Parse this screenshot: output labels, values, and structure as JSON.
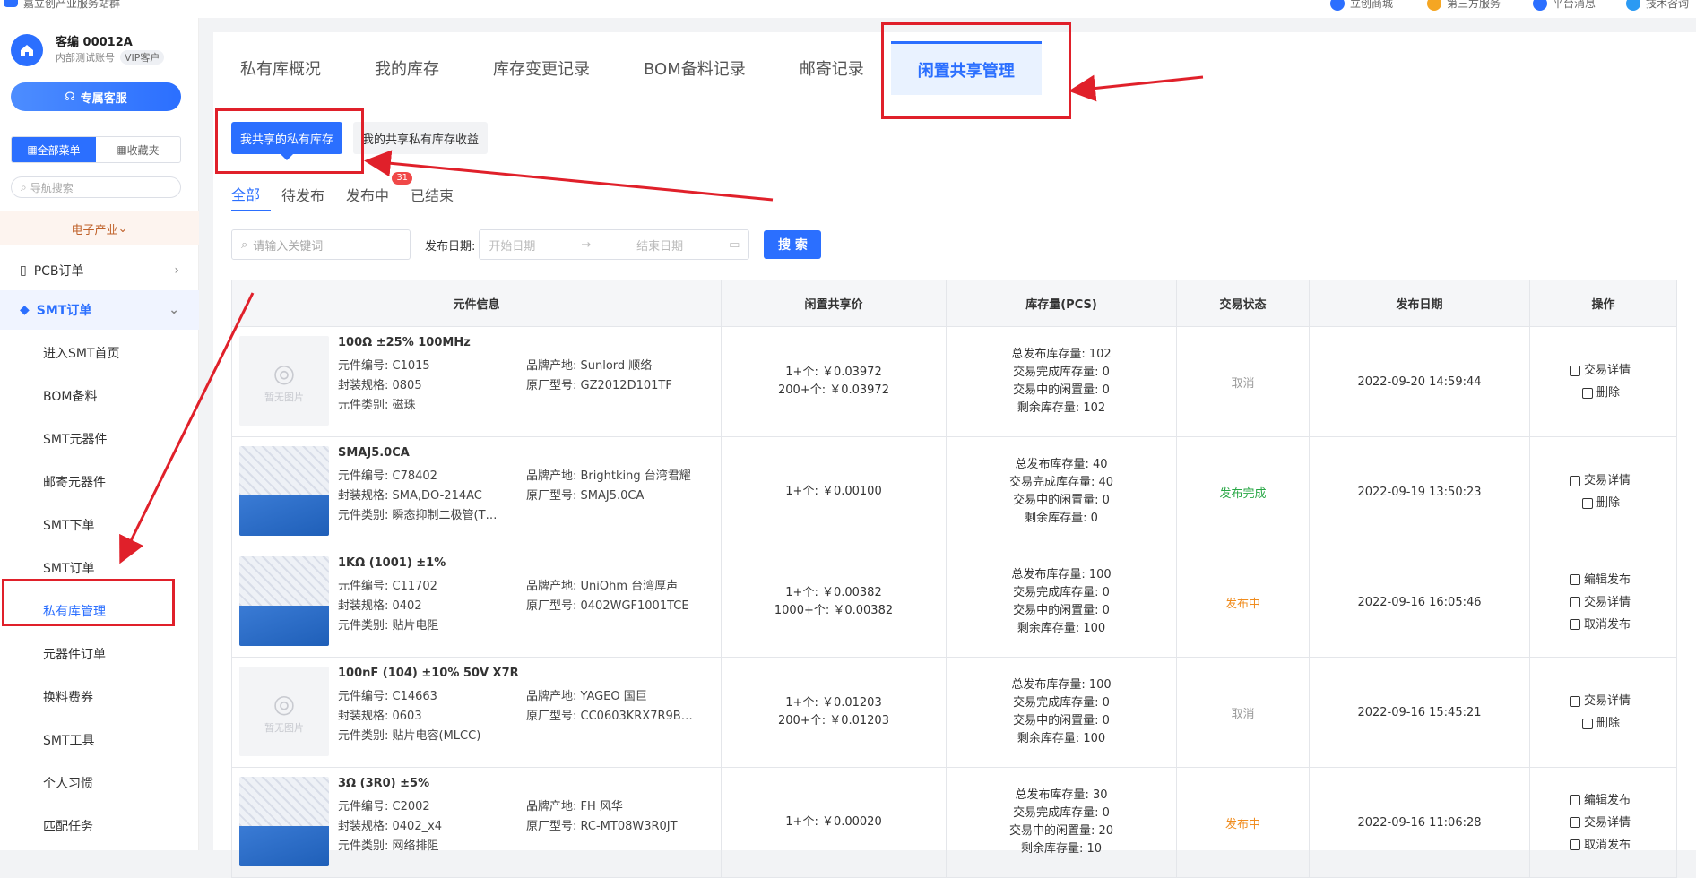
{
  "topbar": {
    "site_name": "嘉立创产业服务站群",
    "links": [
      "立创商城",
      "第三方服务",
      "平台消息",
      "技术咨询"
    ]
  },
  "sidebar": {
    "account_name": "客编 00012A",
    "account_sub": "内部测试账号",
    "vip_label": "VIP客户",
    "service_button": "专属客服",
    "menu_tabs": [
      "全部菜单",
      "收藏夹"
    ],
    "nav_search_placeholder": "导航搜索",
    "industry": "电子产业",
    "groups": [
      {
        "label": "PCB订单",
        "expanded": false
      },
      {
        "label": "SMT订单",
        "expanded": true
      }
    ],
    "items": [
      "进入SMT首页",
      "BOM备料",
      "SMT元器件",
      "邮寄元器件",
      "SMT下单",
      "SMT订单",
      "私有库管理",
      "元器件订单",
      "换料费券",
      "SMT工具",
      "个人习惯",
      "匹配任务"
    ],
    "current_item": "私有库管理"
  },
  "page_tabs": [
    "私有库概况",
    "我的库存",
    "库存变更记录",
    "BOM备料记录",
    "邮寄记录",
    "闲置共享管理"
  ],
  "active_page_tab": "闲置共享管理",
  "sub_tabs": [
    "我共享的私有库存",
    "我的共享私有库存收益"
  ],
  "status_tabs": [
    {
      "label": "全部",
      "badge": ""
    },
    {
      "label": "待发布",
      "badge": ""
    },
    {
      "label": "发布中",
      "badge": "31"
    },
    {
      "label": "已结束",
      "badge": ""
    }
  ],
  "filter": {
    "keyword_placeholder": "请输入关键词",
    "date_label": "发布日期:",
    "start_placeholder": "开始日期",
    "end_placeholder": "结束日期",
    "search_label": "搜 索"
  },
  "table": {
    "headers": [
      "元件信息",
      "闲置共享价",
      "库存量(PCS)",
      "交易状态",
      "发布日期",
      "操作"
    ],
    "placeholder_image_text": "暂无图片",
    "rows": [
      {
        "name": "100Ω ±25% 100MHz",
        "thumb": "placeholder",
        "code": "元件编号: C1015",
        "pkg": "封装规格: 0805",
        "cat": "元件类别: 磁珠",
        "brand": "品牌产地: Sunlord 顺络",
        "model": "原厂型号: GZ2012D101TF",
        "prices": [
          "1+个: ￥0.03972",
          "200+个: ￥0.03972"
        ],
        "stock": [
          "总发布库存量: 102",
          "交易完成库存量: 0",
          "交易中的闲置量: 0",
          "剩余库存量: 102"
        ],
        "status": "取消",
        "status_color": "gray",
        "date": "2022-09-20 14:59:44",
        "ops": [
          "交易详情",
          "删除"
        ]
      },
      {
        "name": "SMAJ5.0CA",
        "thumb": "reel",
        "code": "元件编号: C78402",
        "pkg": "封装规格: SMA,DO-214AC",
        "cat": "元件类别: 瞬态抑制二极管(T…",
        "brand": "品牌产地: Brightking 台湾君耀",
        "model": "原厂型号: SMAJ5.0CA",
        "prices": [
          "1+个: ￥0.00100"
        ],
        "stock": [
          "总发布库存量: 40",
          "交易完成库存量: 40",
          "交易中的闲置量: 0",
          "剩余库存量: 0"
        ],
        "status": "发布完成",
        "status_color": "green",
        "date": "2022-09-19 13:50:23",
        "ops": [
          "交易详情",
          "删除"
        ]
      },
      {
        "name": "1KΩ (1001) ±1%",
        "thumb": "reel",
        "code": "元件编号: C11702",
        "pkg": "封装规格: 0402",
        "cat": "元件类别: 贴片电阻",
        "brand": "品牌产地: UniOhm 台湾厚声",
        "model": "原厂型号: 0402WGF1001TCE",
        "prices": [
          "1+个: ￥0.00382",
          "1000+个: ￥0.00382"
        ],
        "stock": [
          "总发布库存量: 100",
          "交易完成库存量: 0",
          "交易中的闲置量: 0",
          "剩余库存量: 100"
        ],
        "status": "发布中",
        "status_color": "orange",
        "date": "2022-09-16 16:05:46",
        "ops": [
          "编辑发布",
          "交易详情",
          "取消发布"
        ]
      },
      {
        "name": "100nF (104) ±10% 50V X7R",
        "thumb": "placeholder",
        "code": "元件编号: C14663",
        "pkg": "封装规格: 0603",
        "cat": "元件类别: 贴片电容(MLCC)",
        "brand": "品牌产地: YAGEO 国巨",
        "model": "原厂型号: CC0603KRX7R9B…",
        "prices": [
          "1+个: ￥0.01203",
          "200+个: ￥0.01203"
        ],
        "stock": [
          "总发布库存量: 100",
          "交易完成库存量: 0",
          "交易中的闲置量: 0",
          "剩余库存量: 100"
        ],
        "status": "取消",
        "status_color": "gray",
        "date": "2022-09-16 15:45:21",
        "ops": [
          "交易详情",
          "删除"
        ]
      },
      {
        "name": "3Ω (3R0) ±5%",
        "thumb": "reel",
        "code": "元件编号: C2002",
        "pkg": "封装规格: 0402_x4",
        "cat": "元件类别: 网络排阻",
        "brand": "品牌产地: FH 风华",
        "model": "原厂型号: RC-MT08W3R0JT",
        "prices": [
          "1+个: ￥0.00020"
        ],
        "stock": [
          "总发布库存量: 30",
          "交易完成库存量: 0",
          "交易中的闲置量: 20",
          "剩余库存量: 10"
        ],
        "status": "发布中",
        "status_color": "orange",
        "date": "2022-09-16 11:06:28",
        "ops": [
          "编辑发布",
          "交易详情",
          "取消发布"
        ]
      }
    ]
  },
  "colors": {
    "accent": "#2b6fff",
    "annotation": "#e0202a"
  }
}
